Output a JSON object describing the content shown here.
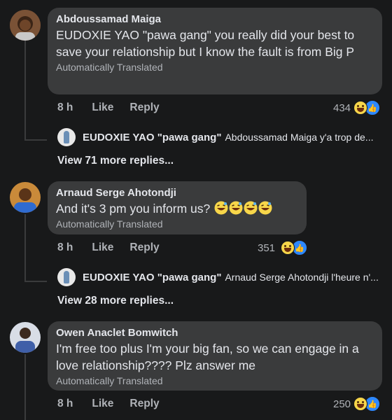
{
  "comments": [
    {
      "author": "Abdoussamad Maiga",
      "text": "EUDOXIE YAO \"pawa gang\" you really did your best to save your relationship but I know the fault is from Big P",
      "translated": "Automatically Translated",
      "time": "8 h",
      "like": "Like",
      "reply": "Reply",
      "reactions": "434",
      "reply_author": "EUDOXIE YAO \"pawa gang\"",
      "reply_text": "Abdoussamad Maiga y'a trop de...",
      "view_more": "View 71 more replies..."
    },
    {
      "author": "Arnaud Serge Ahotondji",
      "text": "And it's 3 pm you inform us?",
      "translated": "Automatically Translated",
      "time": "8 h",
      "like": "Like",
      "reply": "Reply",
      "reactions": "351",
      "reply_author": "EUDOXIE YAO \"pawa gang\"",
      "reply_text": "Arnaud Serge Ahotondji l'heure n'...",
      "view_more": "View 28 more replies..."
    },
    {
      "author": "Owen Anaclet Bomwitch",
      "text": "I'm free too plus I'm your big fan, so we can engage in a love relationship???? Plz answer me",
      "translated": "Automatically Translated",
      "time": "8 h",
      "like": "Like",
      "reply": "Reply",
      "reactions": "250"
    }
  ],
  "colors": {
    "background": "#18191a",
    "bubble": "#3a3b3c",
    "primary_text": "#e4e6eb",
    "secondary_text": "#b0b3b8",
    "like_blue": "#2d88ff",
    "haha_yellow": "#f7d64a"
  },
  "icons": [
    "avatar",
    "haha-reaction-icon",
    "like-reaction-icon",
    "sweat-smile-emoji"
  ]
}
